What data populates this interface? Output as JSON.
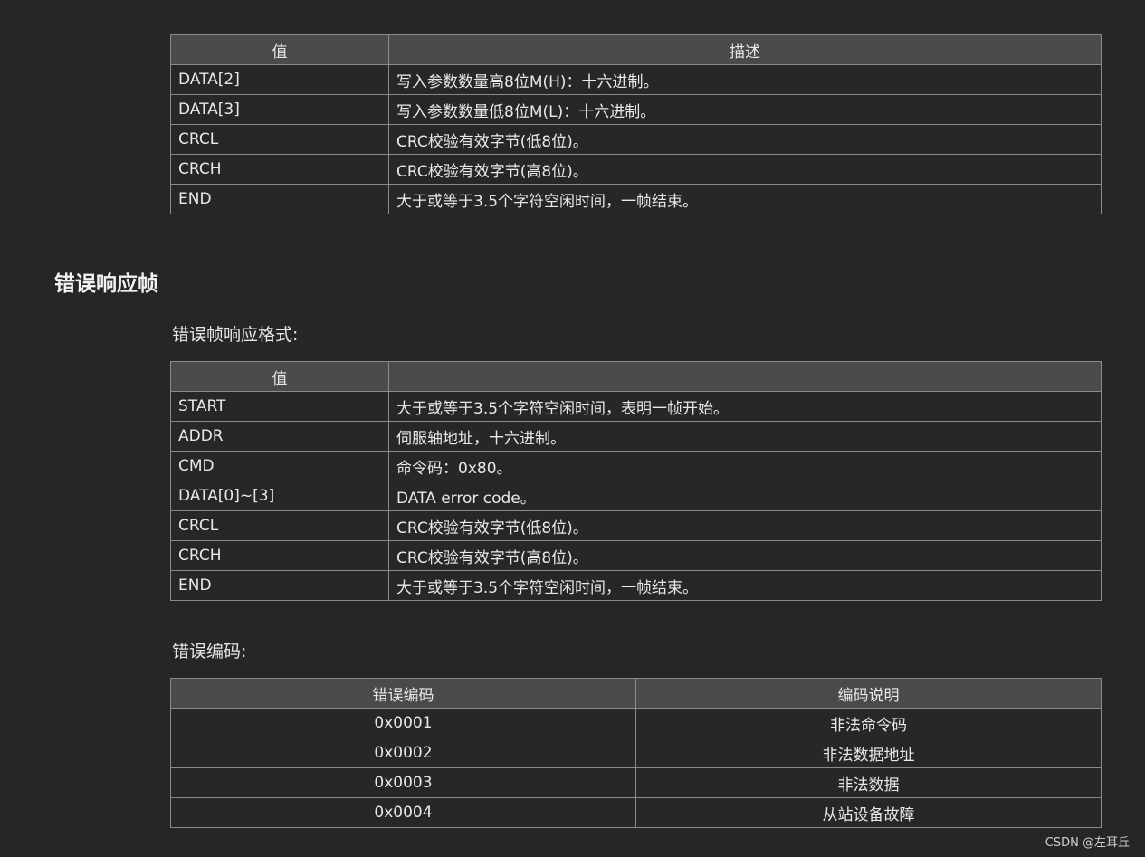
{
  "table1": {
    "headers": [
      "值",
      "描述"
    ],
    "rows": [
      [
        "DATA[2]",
        "写入参数数量高8位M(H)：十六进制。"
      ],
      [
        "DATA[3]",
        "写入参数数量低8位M(L)：十六进制。"
      ],
      [
        "CRCL",
        "CRC校验有效字节(低8位)。"
      ],
      [
        "CRCH",
        "CRC校验有效字节(高8位)。"
      ],
      [
        "END",
        "大于或等于3.5个字符空闲时间，一帧结束。"
      ]
    ]
  },
  "section": {
    "heading": "错误响应帧",
    "format_label": "错误帧响应格式:",
    "codes_label": "错误编码:"
  },
  "table2": {
    "headers": [
      "值",
      ""
    ],
    "rows": [
      [
        "START",
        "大于或等于3.5个字符空闲时间，表明一帧开始。"
      ],
      [
        "ADDR",
        "伺服轴地址，十六进制。"
      ],
      [
        "CMD",
        "命令码：0x80。"
      ],
      [
        "DATA[0]~[3]",
        "DATA error code。"
      ],
      [
        "CRCL",
        "CRC校验有效字节(低8位)。"
      ],
      [
        "CRCH",
        "CRC校验有效字节(高8位)。"
      ],
      [
        "END",
        "大于或等于3.5个字符空闲时间，一帧结束。"
      ]
    ]
  },
  "table3": {
    "headers": [
      "错误编码",
      "编码说明"
    ],
    "rows": [
      [
        "0x0001",
        "非法命令码"
      ],
      [
        "0x0002",
        "非法数据地址"
      ],
      [
        "0x0003",
        "非法数据"
      ],
      [
        "0x0004",
        "从站设备故障"
      ]
    ]
  },
  "watermark": "CSDN @左耳丘"
}
